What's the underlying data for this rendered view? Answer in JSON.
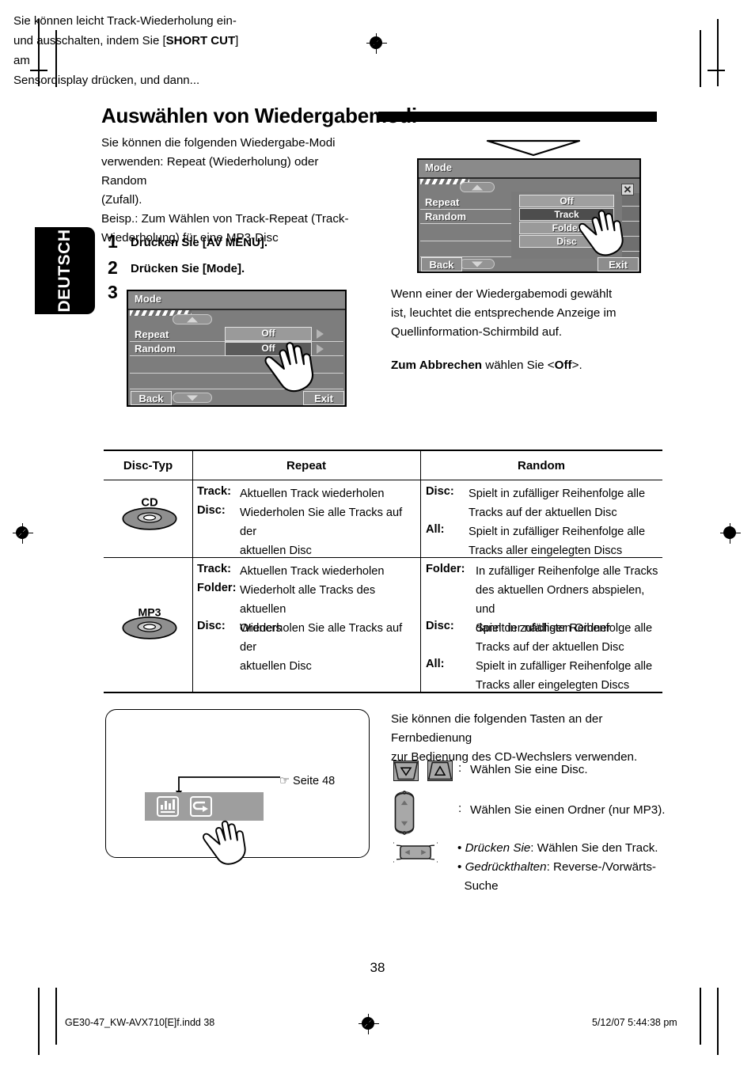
{
  "language_tab": "DEUTSCH",
  "heading": {
    "title": "Auswählen von Wiedergabemodi"
  },
  "intro": {
    "line1": "Sie können die folgenden Wiedergabe-Modi",
    "line2": "verwenden: Repeat (Wiederholung) oder Random",
    "line3": "(Zufall).",
    "line4": "Beisp.: Zum Wählen von Track-Repeat (Track-",
    "line5": "Wiederholung) für eine MP3-Disc"
  },
  "steps": [
    {
      "num": "1",
      "text": "Drücken Sie [AV MENU]."
    },
    {
      "num": "2",
      "text": "Drücken Sie [Mode]."
    },
    {
      "num": "3",
      "text": ""
    }
  ],
  "screen_step3": {
    "title": "Mode",
    "rows": [
      {
        "label": "Repeat",
        "value": "Off"
      },
      {
        "label": "Random",
        "value": "Off"
      }
    ],
    "back_label": "Back",
    "exit_label": "Exit"
  },
  "screen_result": {
    "title": "Mode",
    "rows": [
      {
        "label": "Repeat"
      },
      {
        "label": "Random"
      }
    ],
    "dropdown": {
      "options": [
        "Off",
        "Track",
        "Folder",
        "Disc"
      ],
      "selected": "Track"
    },
    "close_label": "✕",
    "back_label": "Back",
    "exit_label": "Exit"
  },
  "right_text": {
    "para1_line1": "Wenn einer der Wiedergabemodi gewählt",
    "para1_line2": "ist, leuchtet die entsprechende Anzeige im",
    "para1_line3": "Quellinformation-Schirmbild auf.",
    "cancel_bold": "Zum Abbrechen",
    "cancel_rest": " wählen Sie <",
    "cancel_off": "Off",
    "cancel_tail": ">."
  },
  "table": {
    "headers": [
      "Disc-Typ",
      "Repeat",
      "Random"
    ],
    "rows": [
      {
        "disc_type": "CD",
        "repeat": [
          {
            "term": "Track",
            "desc_lines": [
              "Aktuellen Track wiederholen"
            ]
          },
          {
            "term": "Disc",
            "desc_lines": [
              "Wiederholen Sie alle Tracks auf der",
              "aktuellen Disc"
            ]
          }
        ],
        "random": [
          {
            "term": "Disc",
            "desc_lines": [
              "Spielt in zufälliger Reihenfolge alle",
              "Tracks auf der aktuellen Disc"
            ]
          },
          {
            "term": "All",
            "desc_lines": [
              "Spielt in zufälliger Reihenfolge alle",
              "Tracks aller eingelegten Discs"
            ]
          }
        ]
      },
      {
        "disc_type": "MP3",
        "repeat": [
          {
            "term": "Track",
            "desc_lines": [
              "Aktuellen Track wiederholen"
            ]
          },
          {
            "term": "Folder",
            "desc_lines": [
              "Wiederholt alle Tracks des aktuellen",
              "Ordners"
            ]
          },
          {
            "term": "Disc",
            "desc_lines": [
              "Wiederholen Sie alle Tracks auf der",
              "aktuellen Disc"
            ]
          }
        ],
        "random": [
          {
            "term": "Folder",
            "desc_lines": [
              "In zufälliger Reihenfolge alle Tracks",
              "des aktuellen Ordners abspielen, und",
              "dann der nächsten Ordner"
            ]
          },
          {
            "term": "Disc",
            "desc_lines": [
              "Spielt in zufälliger Reihenfolge alle",
              "Tracks auf der aktuellen Disc"
            ]
          },
          {
            "term": "All",
            "desc_lines": [
              "Spielt in zufälliger Reihenfolge alle",
              "Tracks aller eingelegten Discs"
            ]
          }
        ]
      }
    ]
  },
  "note_box": {
    "line1_a": "Sie können leicht Track-Wiederholung ein-",
    "line2_a": "und ausschalten, indem Sie [",
    "line2_bold": "SHORT CUT",
    "line2_b": "] am",
    "line3": "Sensordisplay drücken, und dann...",
    "page_ref": "☞ Seite 48"
  },
  "remote": {
    "intro_line1": "Sie können die folgenden Tasten an der Fernbedienung",
    "intro_line2": "zur Bedienung des CD-Wechslers verwenden.",
    "rows": [
      {
        "colon": ":",
        "text": "Wählen Sie eine Disc."
      },
      {
        "colon": ":",
        "text": "Wählen Sie einen Ordner (nur MP3)."
      }
    ],
    "track_bullets": [
      {
        "bullet": "•",
        "ital": "Drücken Sie",
        "rest": ": Wählen Sie den Track."
      },
      {
        "bullet": "•",
        "ital": "Gedrückthalten",
        "rest": ": Reverse-/Vorwärts-"
      },
      {
        "bullet": "",
        "ital": "",
        "rest": "Suche"
      }
    ]
  },
  "footer": {
    "page_number": "38",
    "file_info": "GE30-47_KW-AVX710[E]f.indd   38",
    "timestamp": "5/12/07   5:44:38 pm"
  }
}
